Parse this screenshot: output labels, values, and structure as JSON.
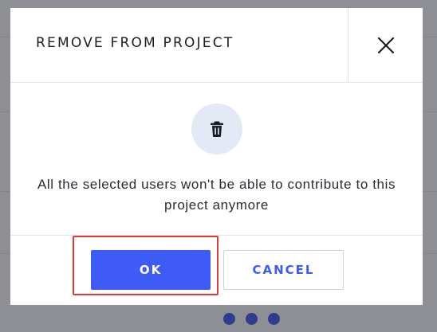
{
  "dialog": {
    "title": "REMOVE FROM PROJECT",
    "close_icon": "close-icon",
    "body_icon": "trash-icon",
    "message": "All the selected users won't be able to contribute to this project anymore",
    "ok_label": "OK",
    "cancel_label": "CANCEL"
  },
  "background": {
    "pager_dots": 3
  },
  "colors": {
    "accent": "#3e5bf6",
    "highlight": "#e0393c",
    "overlay": "#8e8f95",
    "icon_circle": "#e3e9f5"
  }
}
